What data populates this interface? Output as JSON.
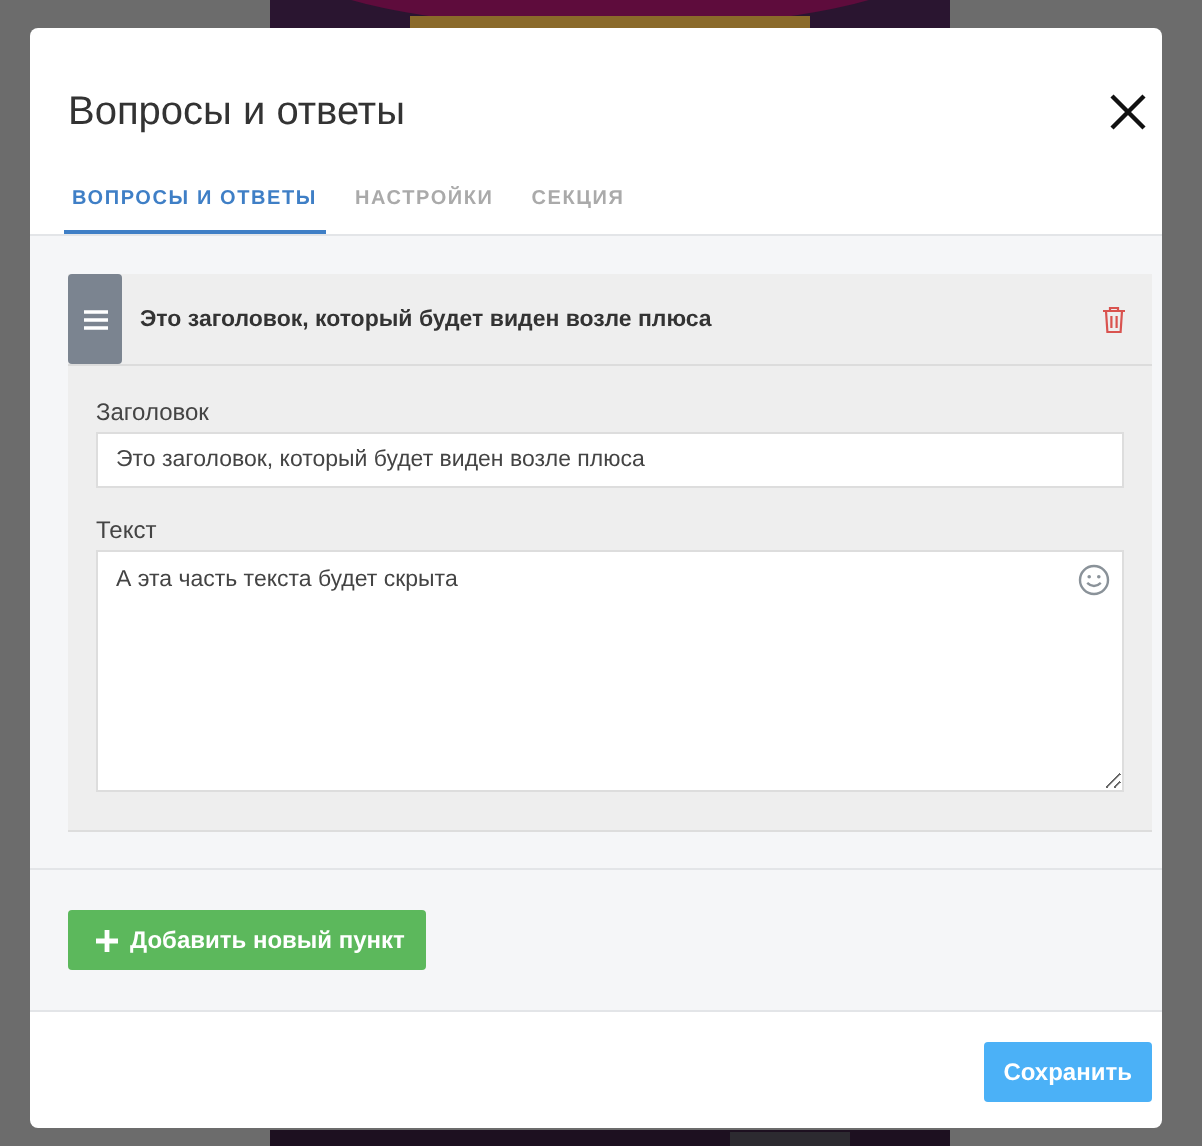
{
  "dialog": {
    "title": "Вопросы и ответы"
  },
  "tabs": [
    {
      "label": "ВОПРОСЫ И ОТВЕТЫ",
      "selected": true
    },
    {
      "label": "НАСТРОЙКИ",
      "selected": false
    },
    {
      "label": "СЕКЦИЯ",
      "selected": false
    }
  ],
  "items": [
    {
      "title": "Это заголовок, который будет виден возле плюса",
      "fields": [
        {
          "kind": "input",
          "label": "Заголовок",
          "value": "Это заголовок, который будет виден возле плюса"
        },
        {
          "kind": "textarea",
          "label": "Текст",
          "value": "А эта часть текста будет скрыта"
        }
      ]
    }
  ],
  "add_button": "Добавить новый пункт",
  "save_button": "Сохранить"
}
